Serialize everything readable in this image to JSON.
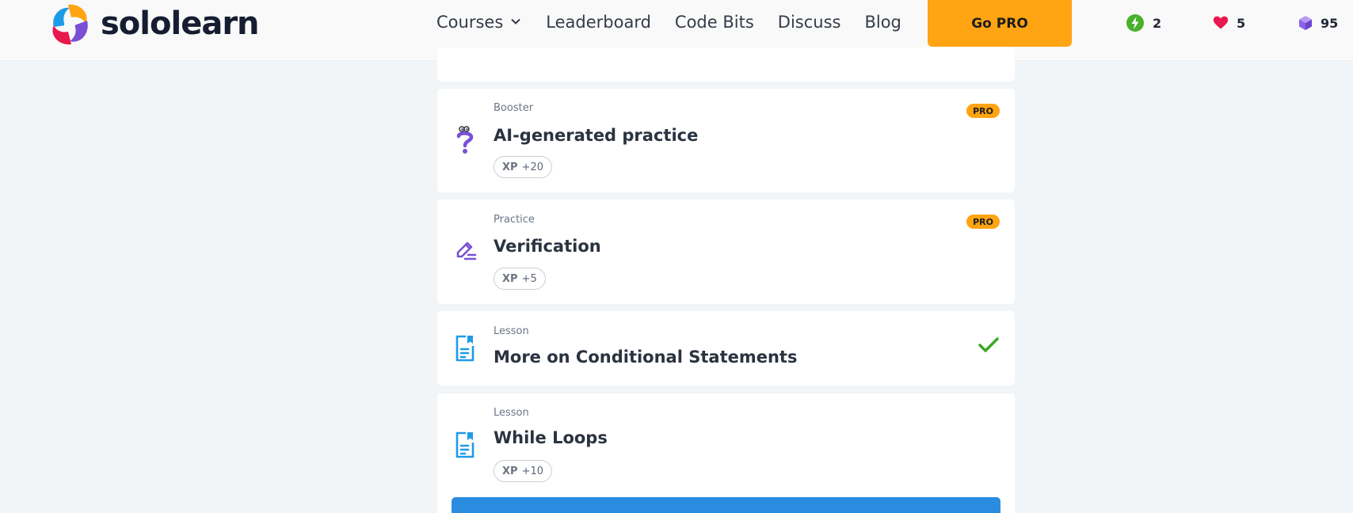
{
  "brand": {
    "name": "sololearn"
  },
  "nav": {
    "courses": "Courses",
    "leaderboard": "Leaderboard",
    "code_bits": "Code Bits",
    "discuss": "Discuss",
    "blog": "Blog",
    "go_pro": "Go PRO"
  },
  "stats": {
    "streak": "2",
    "hearts": "5",
    "bits": "95"
  },
  "items": [
    {
      "type": "Booster",
      "title": "AI-generated practice",
      "xp_label": "XP",
      "xp_value": "+20",
      "badge": "PRO",
      "icon": "question-mark-icon"
    },
    {
      "type": "Practice",
      "title": "Verification",
      "xp_label": "XP",
      "xp_value": "+5",
      "badge": "PRO",
      "icon": "pencil-edit-icon"
    },
    {
      "type": "Lesson",
      "title": "More on Conditional Statements",
      "completed": true,
      "icon": "lesson-document-icon"
    },
    {
      "type": "Lesson",
      "title": "While Loops",
      "xp_label": "XP",
      "xp_value": "+10",
      "icon": "lesson-document-icon"
    }
  ],
  "colors": {
    "accent_orange": "#ffa412",
    "accent_blue": "#2a8cde",
    "purple_icon": "#7a4fd6",
    "blue_icon": "#1e9be8",
    "check_green": "#3aa826",
    "heart_red": "#e8184f",
    "streak_green": "#4bb02c",
    "background": "#f2f5f7"
  }
}
